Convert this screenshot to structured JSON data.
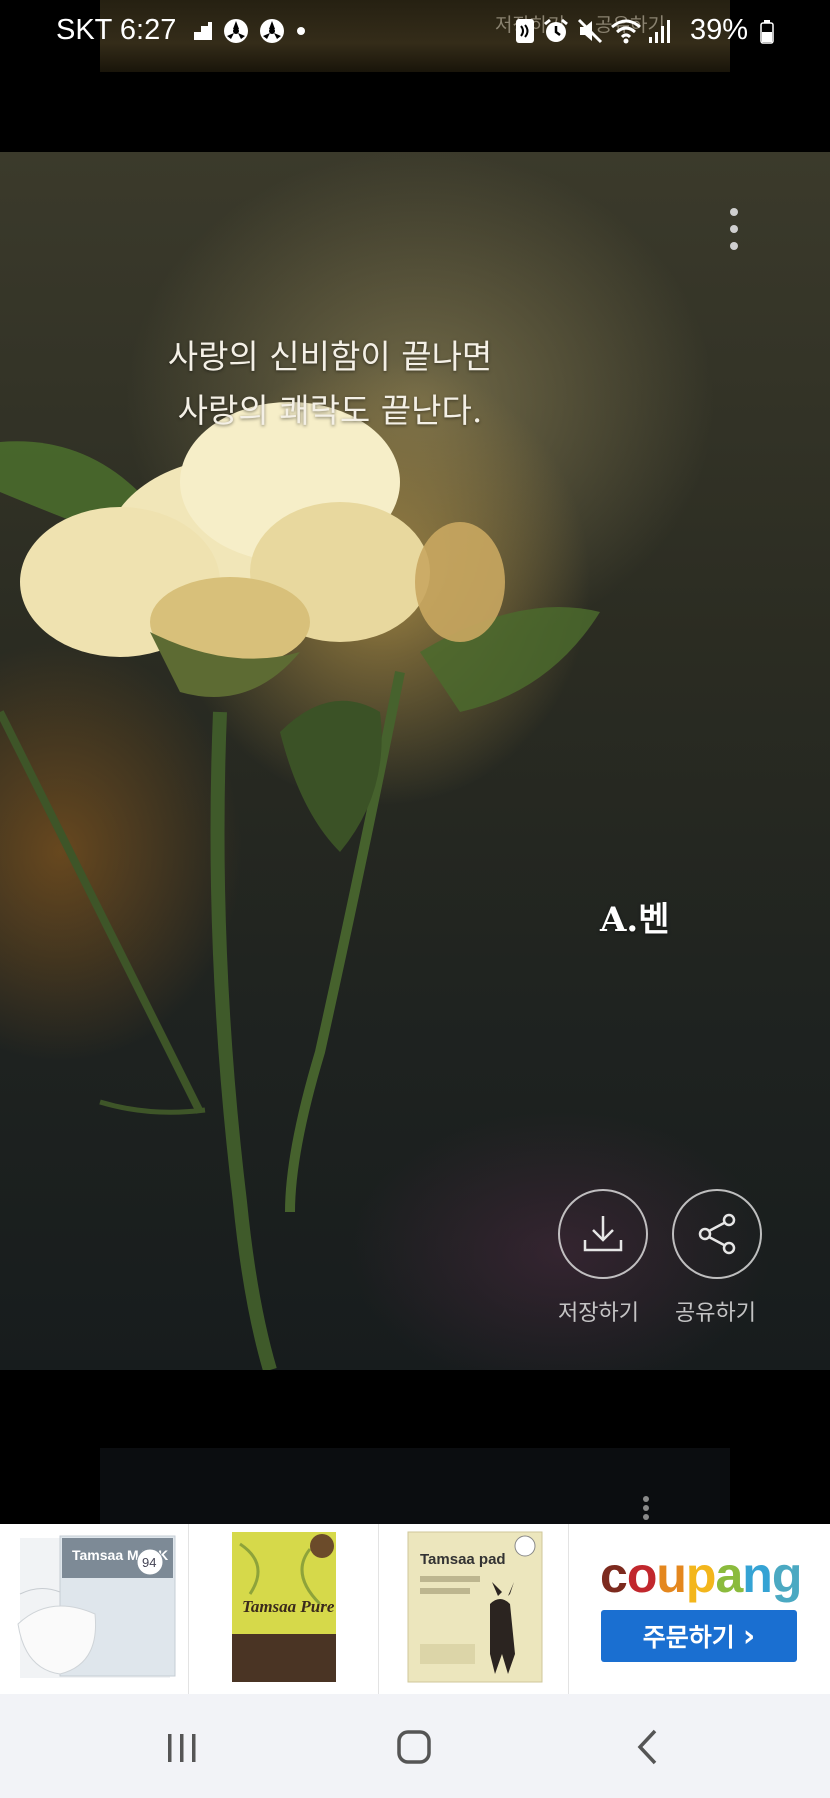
{
  "status_bar": {
    "carrier_time": "SKT 6:27",
    "battery": "39%",
    "left_icons": [
      "signal-data-icon",
      "fan-icon",
      "fan-icon",
      "dot-icon"
    ],
    "right_icons": [
      "nfc-icon",
      "alarm-icon",
      "mute-icon",
      "wifi-icon",
      "cell-signal-icon",
      "battery-icon"
    ]
  },
  "previous_card": {
    "save_label": "저장하기",
    "share_label": "공유하기"
  },
  "card": {
    "quote_line1": "사랑의 신비함이 끝나면",
    "quote_line2": "사랑의 쾌락도 끝난다.",
    "author": "A.벤",
    "save_label": "저장하기",
    "share_label": "공유하기",
    "save_icon": "download-icon",
    "share_icon": "share-icon",
    "menu_icon": "more-vertical-icon"
  },
  "ad": {
    "products": [
      {
        "name": "Tamsaa MASK",
        "badge": "94"
      },
      {
        "name": "Tamsaa Pure"
      },
      {
        "name": "Tamsaa pad"
      }
    ],
    "brand_parts": [
      {
        "text": "c",
        "color": "#7c2a1e"
      },
      {
        "text": "o",
        "color": "#c1272d"
      },
      {
        "text": "u",
        "color": "#e4871e"
      },
      {
        "text": "p",
        "color": "#f3b61c"
      },
      {
        "text": "a",
        "color": "#8bbb3d"
      },
      {
        "text": "n",
        "color": "#35a3d4"
      },
      {
        "text": "g",
        "color": "#4ba9c2"
      }
    ],
    "order_label": "주문하기",
    "order_arrow": "›",
    "button_color": "#1a6fd1"
  },
  "nav_bar": {
    "recent": "recent-apps-icon",
    "home": "home-icon",
    "back": "back-icon"
  }
}
